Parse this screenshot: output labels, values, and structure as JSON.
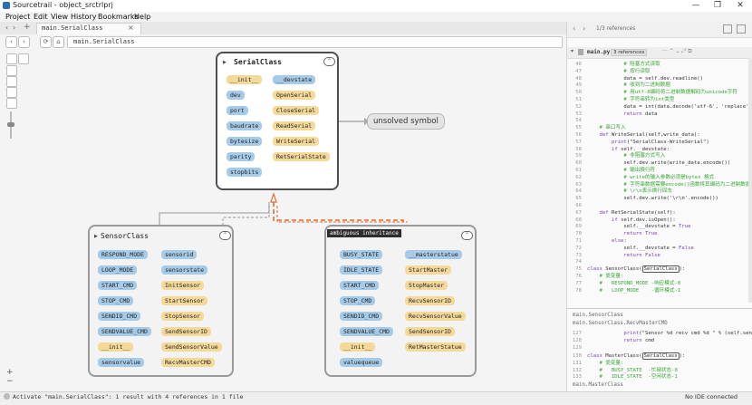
{
  "window": {
    "title": "Sourcetrail - object_srctrlprj"
  },
  "menu": [
    "Project",
    "Edit",
    "View",
    "History",
    "Bookmarks",
    "Help"
  ],
  "tab": {
    "label": "main.SerialClass",
    "close": "×"
  },
  "nav": {
    "back": "‹",
    "forward": "›",
    "refresh": "⟳",
    "home": "⌂",
    "search_chip": "main.SerialClass"
  },
  "graph": {
    "serial_class": {
      "title": "SerialClass",
      "left": [
        "__init__",
        "dev",
        "port",
        "baudrate",
        "bytesize",
        "parity",
        "stopbits"
      ],
      "right": [
        "__devstate",
        "OpenSerial",
        "CloseSerial",
        "ReadSerial",
        "WriteSerial",
        "RetSerialState"
      ]
    },
    "unsolved_symbol": "unsolved symbol",
    "sensor_class": {
      "title": "SensorClass",
      "left": [
        "RESPOND_MODE",
        "LOOP_MODE",
        "START_CMD",
        "STOP_CMD",
        "SENDID_CMD",
        "SENDVALUE_CMD",
        "__init__",
        "sensorvalue"
      ],
      "right": [
        "sensorid",
        "sensorstate",
        "InitSensor",
        "StartSensor",
        "StopSensor",
        "SendSensorID",
        "SendSensorValue",
        "RecvMasterCMD"
      ]
    },
    "master_class": {
      "badge": "ambiguous inheritance",
      "left": [
        "BUSY_STATE",
        "IDLE_STATE",
        "START_CMD",
        "STOP_CMD",
        "SENDID_CMD",
        "SENDVALUE_CMD",
        "__init__",
        "valuequeue"
      ],
      "right": [
        "__masterstatue",
        "StartMaster",
        "StopMaster",
        "RecvSensorID",
        "RecvSensorValue",
        "SendSensorID",
        "RetMasterStatue"
      ]
    }
  },
  "code_panel": {
    "references": "1/3 references",
    "file": "main.py",
    "file_refs": "3 references",
    "lines_a": [
      "46",
      "47",
      "48",
      "49",
      "50",
      "51",
      "52",
      "53",
      "54",
      "55",
      "56",
      "57",
      "58",
      "59",
      "60",
      "61",
      "62",
      "63",
      "64",
      "65",
      "66",
      "67",
      "68",
      "69",
      "70",
      "71",
      "72",
      "73",
      "74",
      "75",
      "76",
      "77",
      "78"
    ],
    "code_a": [
      "            # 阻塞方式读取",
      "            # 按行读取",
      "            data = self.dev.readline()",
      "            # 收到为二进制数据",
      "            # 用utf-8编码将二进制数据解码为unicode字符",
      "            # 字符串转为int类型",
      "            data = int(data.decode('utf-6', 'replace'))",
      "            return data",
      "",
      "    # 串口写入",
      "    def WriteSerial(self,write_data):",
      "        print(\"SerialClass-WriteSerial\")",
      "        if self.__devstate:",
      "            # 非阻塞方式写入",
      "            self.dev.write(write_data.encode())",
      "            # 输出换行符",
      "            # write的输入参数必须是bytes 格式",
      "            # 字符串数据需要encode()函数将其编码为二进制数据",
      "            # \\r\\n表示换行回车",
      "            self.dev.write('\\r\\n'.encode())",
      "",
      "    def RetSerialState(self):",
      "        if self.dev.isOpen():",
      "            self.__devstate = True",
      "            return True",
      "        else:",
      "            self.__devstate = False",
      "            return False",
      "",
      "class SensorClass(SerialClass):",
      "    # 类变量:",
      "    #   RESPOND_MODE -响应模式-0",
      "    #   LOOP_MODE    -循环模式-1"
    ],
    "ctx1": "main.SensorClass",
    "ctx2": "main.SensorClass.RecvMasterCMD",
    "lines_b": [
      "127",
      "128",
      "129"
    ],
    "code_b": [
      "            print(\"Sensor %d recv cmd %d \" % (self.sensorid, cmd))",
      "            return cmd",
      ""
    ],
    "lines_c": [
      "130",
      "131",
      "132",
      "133"
    ],
    "code_c": [
      "class MasterClass(SerialClass):",
      "    # 类变量:",
      "    #   BUSY_STATE  -忙碌状态-0",
      "    #   IDLE_STATE  -空闲状态-1"
    ],
    "ctx3": "main.MasterClass"
  },
  "status": {
    "left": "Activate \"main.SerialClass\": 1 result with 4 references in 1 file",
    "right": "No IDE connected"
  }
}
